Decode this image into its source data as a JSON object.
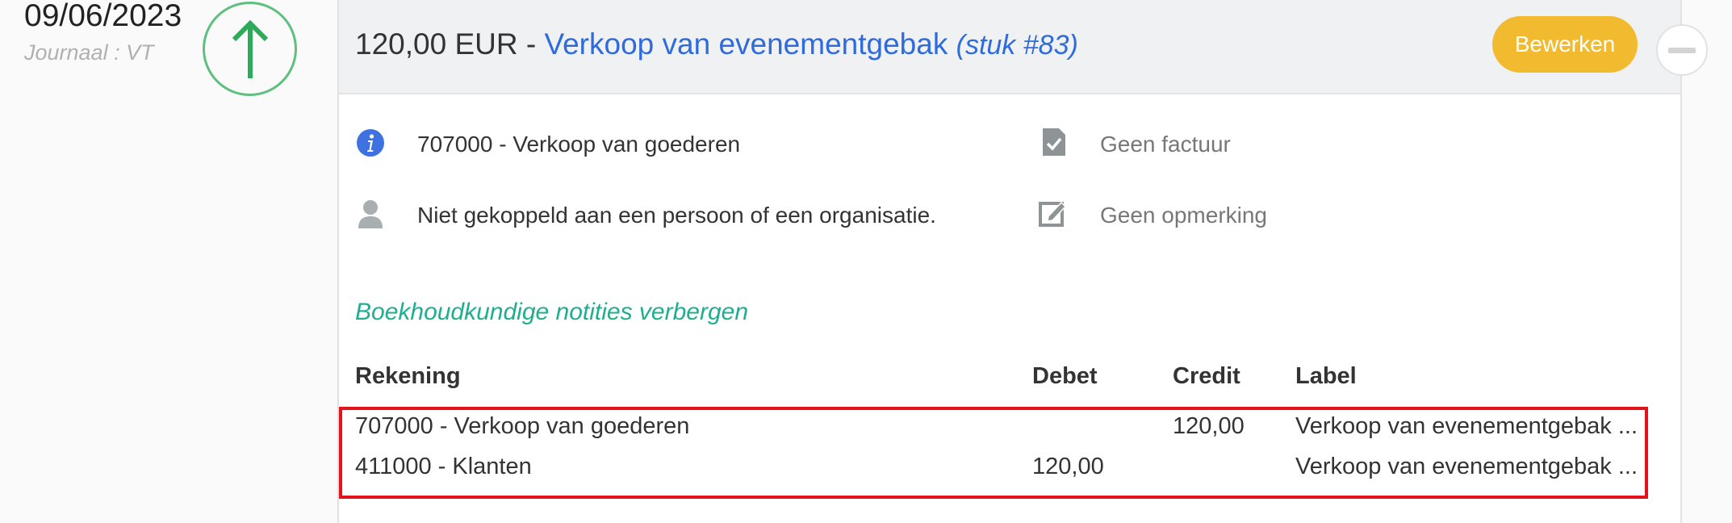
{
  "entry": {
    "date": "09/06/2023",
    "journal": "Journaal : VT",
    "direction_icon": "arrow-up-icon",
    "amount": "120,00 EUR",
    "separator": " - ",
    "description": "Verkoop van evenementgebak",
    "piece": "(stuk #83)",
    "edit_label": "Bewerken",
    "collapse_icon": "minus-icon"
  },
  "details": {
    "account": "707000 - Verkoop van goederen",
    "contact": "Niet gekoppeld aan een persoon of een organisatie.",
    "invoice": "Geen factuur",
    "remark": "Geen opmerking"
  },
  "notes_toggle": "Boekhoudkundige notities verbergen",
  "table": {
    "headers": [
      "Rekening",
      "Debet",
      "Credit",
      "Label"
    ],
    "rows": [
      {
        "account": "707000 - Verkoop van goederen",
        "debit": "",
        "credit": "120,00",
        "label": "Verkoop van evenementgebak ..."
      },
      {
        "account": "411000 - Klanten",
        "debit": "120,00",
        "credit": "",
        "label": "Verkoop van evenementgebak ..."
      }
    ]
  },
  "colors": {
    "accent_green": "#5fbf7f",
    "link_blue": "#2f6bdb",
    "button_yellow": "#f2ba2f",
    "notes_teal": "#1fae8f",
    "highlight_red": "#e3121b"
  }
}
